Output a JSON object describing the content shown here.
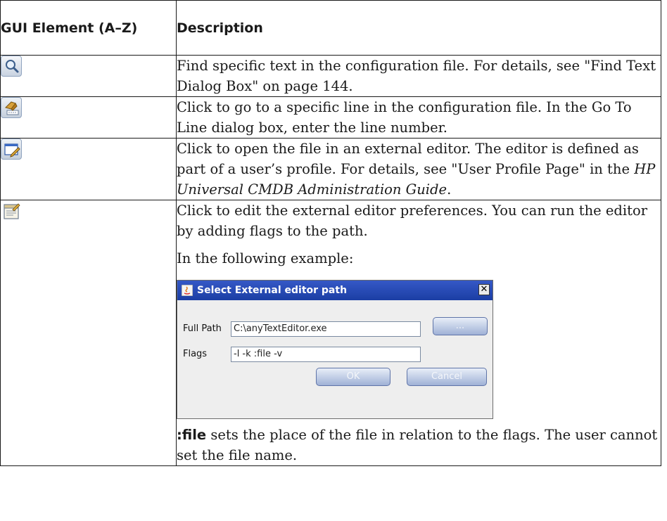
{
  "header": {
    "col1": "GUI Element (A–Z)",
    "col2": "Description"
  },
  "rows": [
    {
      "icon": "find-text-icon",
      "text": "Find specific text in the configuration file. For details, see \"Find Text Dialog Box\" on page 144."
    },
    {
      "icon": "go-to-line-icon",
      "text": "Click to go to a specific line in the configuration file. In the Go To Line dialog box, enter the line number."
    },
    {
      "icon": "external-editor-icon",
      "text_before": "Click to open the file in an external editor. The editor is defined as part of a user’s profile. For details, see \"User Profile Page\" in the ",
      "text_italic": "HP Universal CMDB Administration Guide",
      "text_after": "."
    },
    {
      "icon": "editor-preferences-icon",
      "text": "Click to edit the external editor preferences. You can run the editor by adding flags to the path.",
      "example_intro": "In the following example:",
      "note_bold": ":file",
      "note_rest": " sets the place of the file in relation to the flags. The user cannot set the file name."
    }
  ],
  "dialog": {
    "title": "Select External editor path",
    "close": "✕",
    "full_path_label": "Full Path",
    "full_path_value": "C:\\anyTextEditor.exe",
    "browse_label": "...",
    "flags_label": "Flags",
    "flags_value": "-l -k :file -v",
    "ok_label": "OK",
    "cancel_label": "Cancel"
  }
}
